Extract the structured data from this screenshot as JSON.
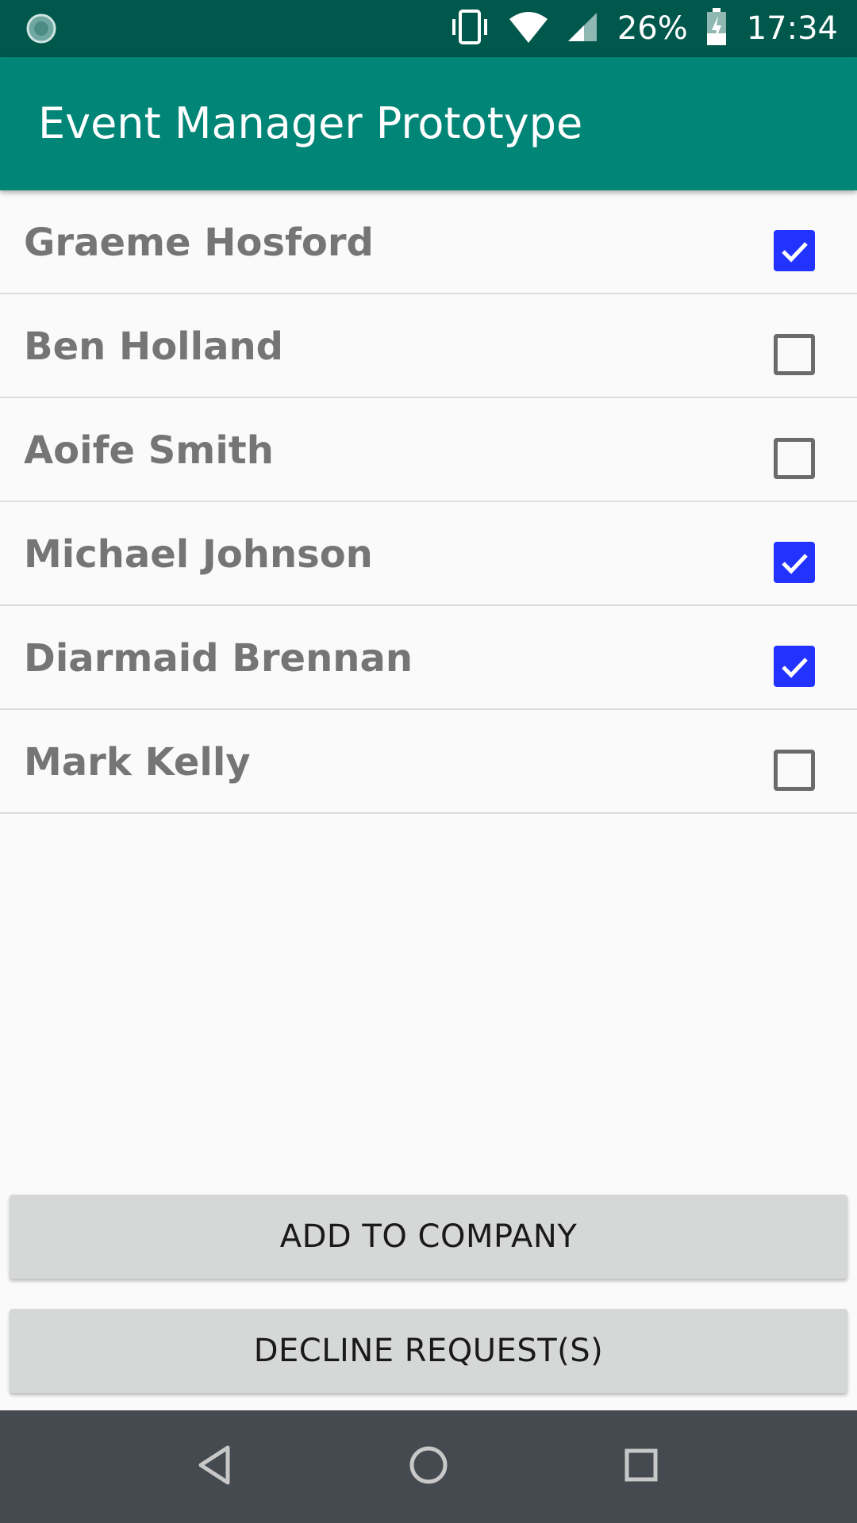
{
  "status_bar": {
    "battery": "26%",
    "time": "17:34",
    "left_icon": "sync-spinner-icon",
    "right_icons": [
      "vibrate-icon",
      "wifi-icon",
      "signal-icon",
      "battery-charging-icon"
    ]
  },
  "app_bar": {
    "title": "Event Manager Prototype",
    "color": "#008577"
  },
  "requests": [
    {
      "name": "Graeme Hosford",
      "checked": true
    },
    {
      "name": "Ben Holland",
      "checked": false
    },
    {
      "name": "Aoife Smith",
      "checked": false
    },
    {
      "name": "Michael Johnson",
      "checked": true
    },
    {
      "name": "Diarmaid Brennan",
      "checked": true
    },
    {
      "name": "Mark Kelly",
      "checked": false
    }
  ],
  "actions": {
    "add_label": "ADD TO COMPANY",
    "decline_label": "DECLINE REQUEST(S)"
  },
  "nav_bar": {
    "icons": [
      "back-icon",
      "home-icon",
      "recents-icon"
    ]
  },
  "colors": {
    "status_bar": "#00574b",
    "checkbox_checked": "#2233ff"
  }
}
